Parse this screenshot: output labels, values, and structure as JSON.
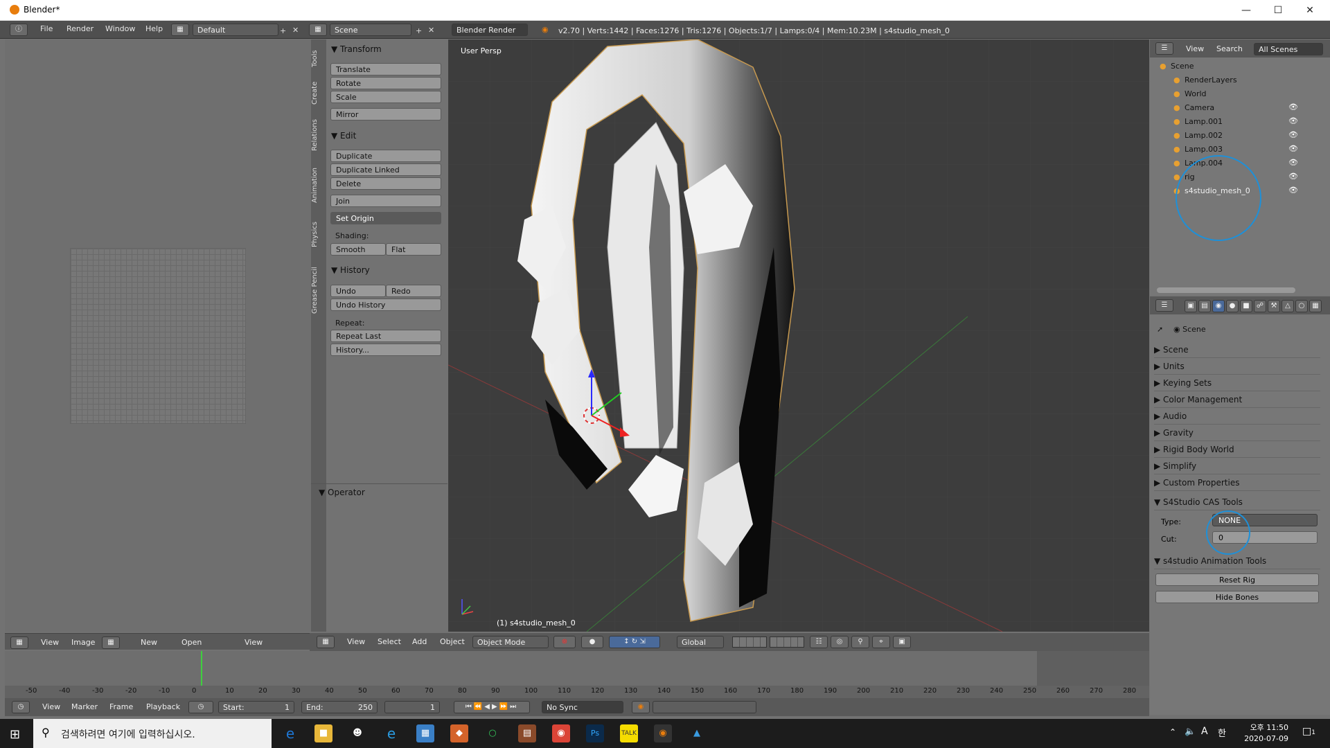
{
  "window": {
    "title": "Blender*"
  },
  "infobar": {
    "menus": [
      "File",
      "Render",
      "Window",
      "Help"
    ],
    "layout": "Default",
    "scene": "Scene",
    "engine": "Blender Render",
    "stats": "v2.70 | Verts:1442 | Faces:1276 | Tris:1276 | Objects:1/7 | Lamps:0/4 | Mem:10.23M | s4studio_mesh_0"
  },
  "toolshelf": {
    "tabs": [
      "Tools",
      "Create",
      "Relations",
      "Animation",
      "Physics",
      "Grease Pencil"
    ],
    "transform": {
      "title": "Transform",
      "buttons": [
        "Translate",
        "Rotate",
        "Scale",
        "Mirror"
      ]
    },
    "edit": {
      "title": "Edit",
      "buttons": [
        "Duplicate",
        "Duplicate Linked",
        "Delete",
        "Join"
      ],
      "set_origin": "Set Origin",
      "shading_label": "Shading:",
      "smooth": "Smooth",
      "flat": "Flat"
    },
    "history": {
      "title": "History",
      "undo": "Undo",
      "redo": "Redo",
      "undo_history": "Undo History",
      "repeat_label": "Repeat:",
      "repeat_last": "Repeat Last",
      "history": "History..."
    },
    "operator": "Operator"
  },
  "viewport": {
    "label": "User Persp",
    "object_label": "(1) s4studio_mesh_0"
  },
  "image_editor_header": {
    "view": "View",
    "image": "Image",
    "new": "New",
    "open": "Open",
    "view2": "View"
  },
  "view3d_header": {
    "view": "View",
    "select": "Select",
    "add": "Add",
    "object": "Object",
    "mode": "Object Mode",
    "orientation": "Global"
  },
  "outliner": {
    "view": "View",
    "search": "Search",
    "scope": "All Scenes",
    "items": [
      {
        "name": "Scene",
        "indent": 0
      },
      {
        "name": "RenderLayers",
        "indent": 1
      },
      {
        "name": "World",
        "indent": 1
      },
      {
        "name": "Camera",
        "indent": 1
      },
      {
        "name": "Lamp.001",
        "indent": 1
      },
      {
        "name": "Lamp.002",
        "indent": 1
      },
      {
        "name": "Lamp.003",
        "indent": 1
      },
      {
        "name": "Lamp.004",
        "indent": 1
      },
      {
        "name": "rig",
        "indent": 1
      },
      {
        "name": "s4studio_mesh_0",
        "indent": 1
      }
    ]
  },
  "properties": {
    "context": "Scene",
    "sections": [
      "Scene",
      "Units",
      "Keying Sets",
      "Color Management",
      "Audio",
      "Gravity",
      "Rigid Body World",
      "Simplify",
      "Custom Properties"
    ],
    "cas_tools": {
      "title": "S4Studio CAS Tools",
      "type_label": "Type:",
      "type_value": "NONE",
      "cut_label": "Cut:",
      "cut_value": "0"
    },
    "anim_tools": {
      "title": "s4studio Animation Tools",
      "reset_rig": "Reset Rig",
      "hide_bones": "Hide Bones"
    }
  },
  "timeline": {
    "ticks": [
      "-50",
      "-40",
      "-30",
      "-20",
      "-10",
      "0",
      "10",
      "20",
      "30",
      "40",
      "50",
      "60",
      "70",
      "80",
      "90",
      "100",
      "110",
      "120",
      "130",
      "140",
      "150",
      "160",
      "170",
      "180",
      "190",
      "200",
      "210",
      "220",
      "230",
      "240",
      "250",
      "260",
      "270",
      "280"
    ],
    "view": "View",
    "marker": "Marker",
    "frame": "Frame",
    "playback": "Playback",
    "start_label": "Start:",
    "start": "1",
    "end_label": "End:",
    "end": "250",
    "current": "1",
    "sync": "No Sync"
  },
  "taskbar": {
    "search": "검색하려면 여기에 입력하십시오.",
    "time": "오후 11:50",
    "date": "2020-07-09",
    "lang": "A",
    "notif": "1"
  },
  "colors": {
    "accent_circle": "#1e90d8",
    "selected": "#f0f0f0"
  }
}
